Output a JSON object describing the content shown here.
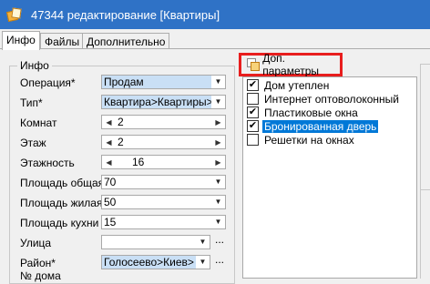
{
  "window": {
    "title": "47344 редактирование [Квартиры]"
  },
  "tabs": [
    {
      "label": "Инфо"
    },
    {
      "label": "Файлы"
    },
    {
      "label": "Дополнительно"
    }
  ],
  "info_group": {
    "title": "Инфо",
    "fields": {
      "operation": {
        "label": "Операция*",
        "value": "Продам"
      },
      "type": {
        "label": "Тип*",
        "value": "Квартира>Квартиры>"
      },
      "rooms": {
        "label": "Комнат",
        "value": "2"
      },
      "floor": {
        "label": "Этаж",
        "value": "2"
      },
      "floors": {
        "label": "Этажность",
        "value": "16"
      },
      "area_total": {
        "label": "Площадь общая",
        "value": "70"
      },
      "area_living": {
        "label": "Площадь жилая",
        "value": "50"
      },
      "area_kitchen": {
        "label": "Площадь кухни",
        "value": "15"
      },
      "street": {
        "label": "Улица",
        "value": ""
      },
      "district": {
        "label": "Район*",
        "value": "Голосеево>Киев>"
      },
      "house_no": {
        "label": "№ дома",
        "value": ""
      }
    },
    "ellipsis": "..."
  },
  "extra_params": {
    "label": "Доп. параметры",
    "items": [
      {
        "label": "Дом утеплен",
        "checked": true,
        "selected": false
      },
      {
        "label": "Интернет оптоволоконный",
        "checked": false,
        "selected": false
      },
      {
        "label": "Пластиковые окна",
        "checked": true,
        "selected": false
      },
      {
        "label": "Бронированная дверь",
        "checked": true,
        "selected": true
      },
      {
        "label": "Решетки на окнах",
        "checked": false,
        "selected": false
      }
    ]
  },
  "glyphs": {
    "dropdown": "▼",
    "spin_left": "◀",
    "spin_right": "▶",
    "check": "✔"
  },
  "colors": {
    "titlebar": "#2f72c6",
    "highlight": "#0078d7",
    "callout_border": "#e81e1e"
  }
}
